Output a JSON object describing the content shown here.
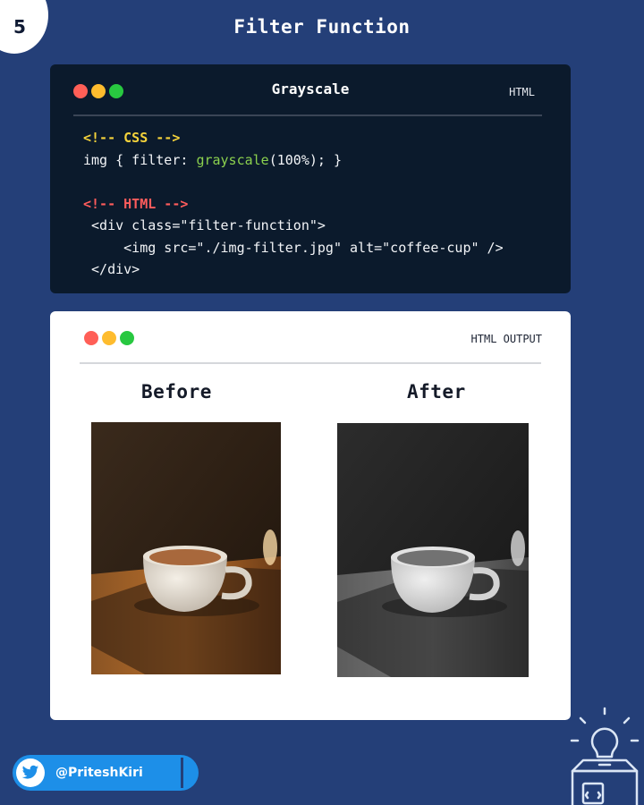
{
  "page": {
    "number": "5",
    "title": "Filter Function"
  },
  "colors": {
    "background": "#243f78",
    "dot_red": "#ff5f57",
    "dot_yellow": "#febc2e",
    "dot_green": "#28c840",
    "twitter_blue": "#1d8fe8"
  },
  "code_window": {
    "title": "Grayscale",
    "language": "HTML",
    "code": {
      "css_comment": "<!-- CSS -->",
      "css_line_prefix": "img { filter: ",
      "css_function": "grayscale",
      "css_line_suffix": "(100%); }",
      "html_comment": "<!-- HTML -->",
      "html_line_1": " <div class=\"filter-function\">",
      "html_line_2": "     <img src=\"./img-filter.jpg\" alt=\"coffee-cup\" />",
      "html_line_3": " </div>"
    }
  },
  "output_window": {
    "label": "HTML OUTPUT",
    "before_label": "Before",
    "after_label": "After"
  },
  "footer": {
    "twitter_handle": "@PriteshKiri",
    "icon": "twitter-bird-icon"
  },
  "logo": {
    "icon": "lightbulb-box-logo"
  }
}
